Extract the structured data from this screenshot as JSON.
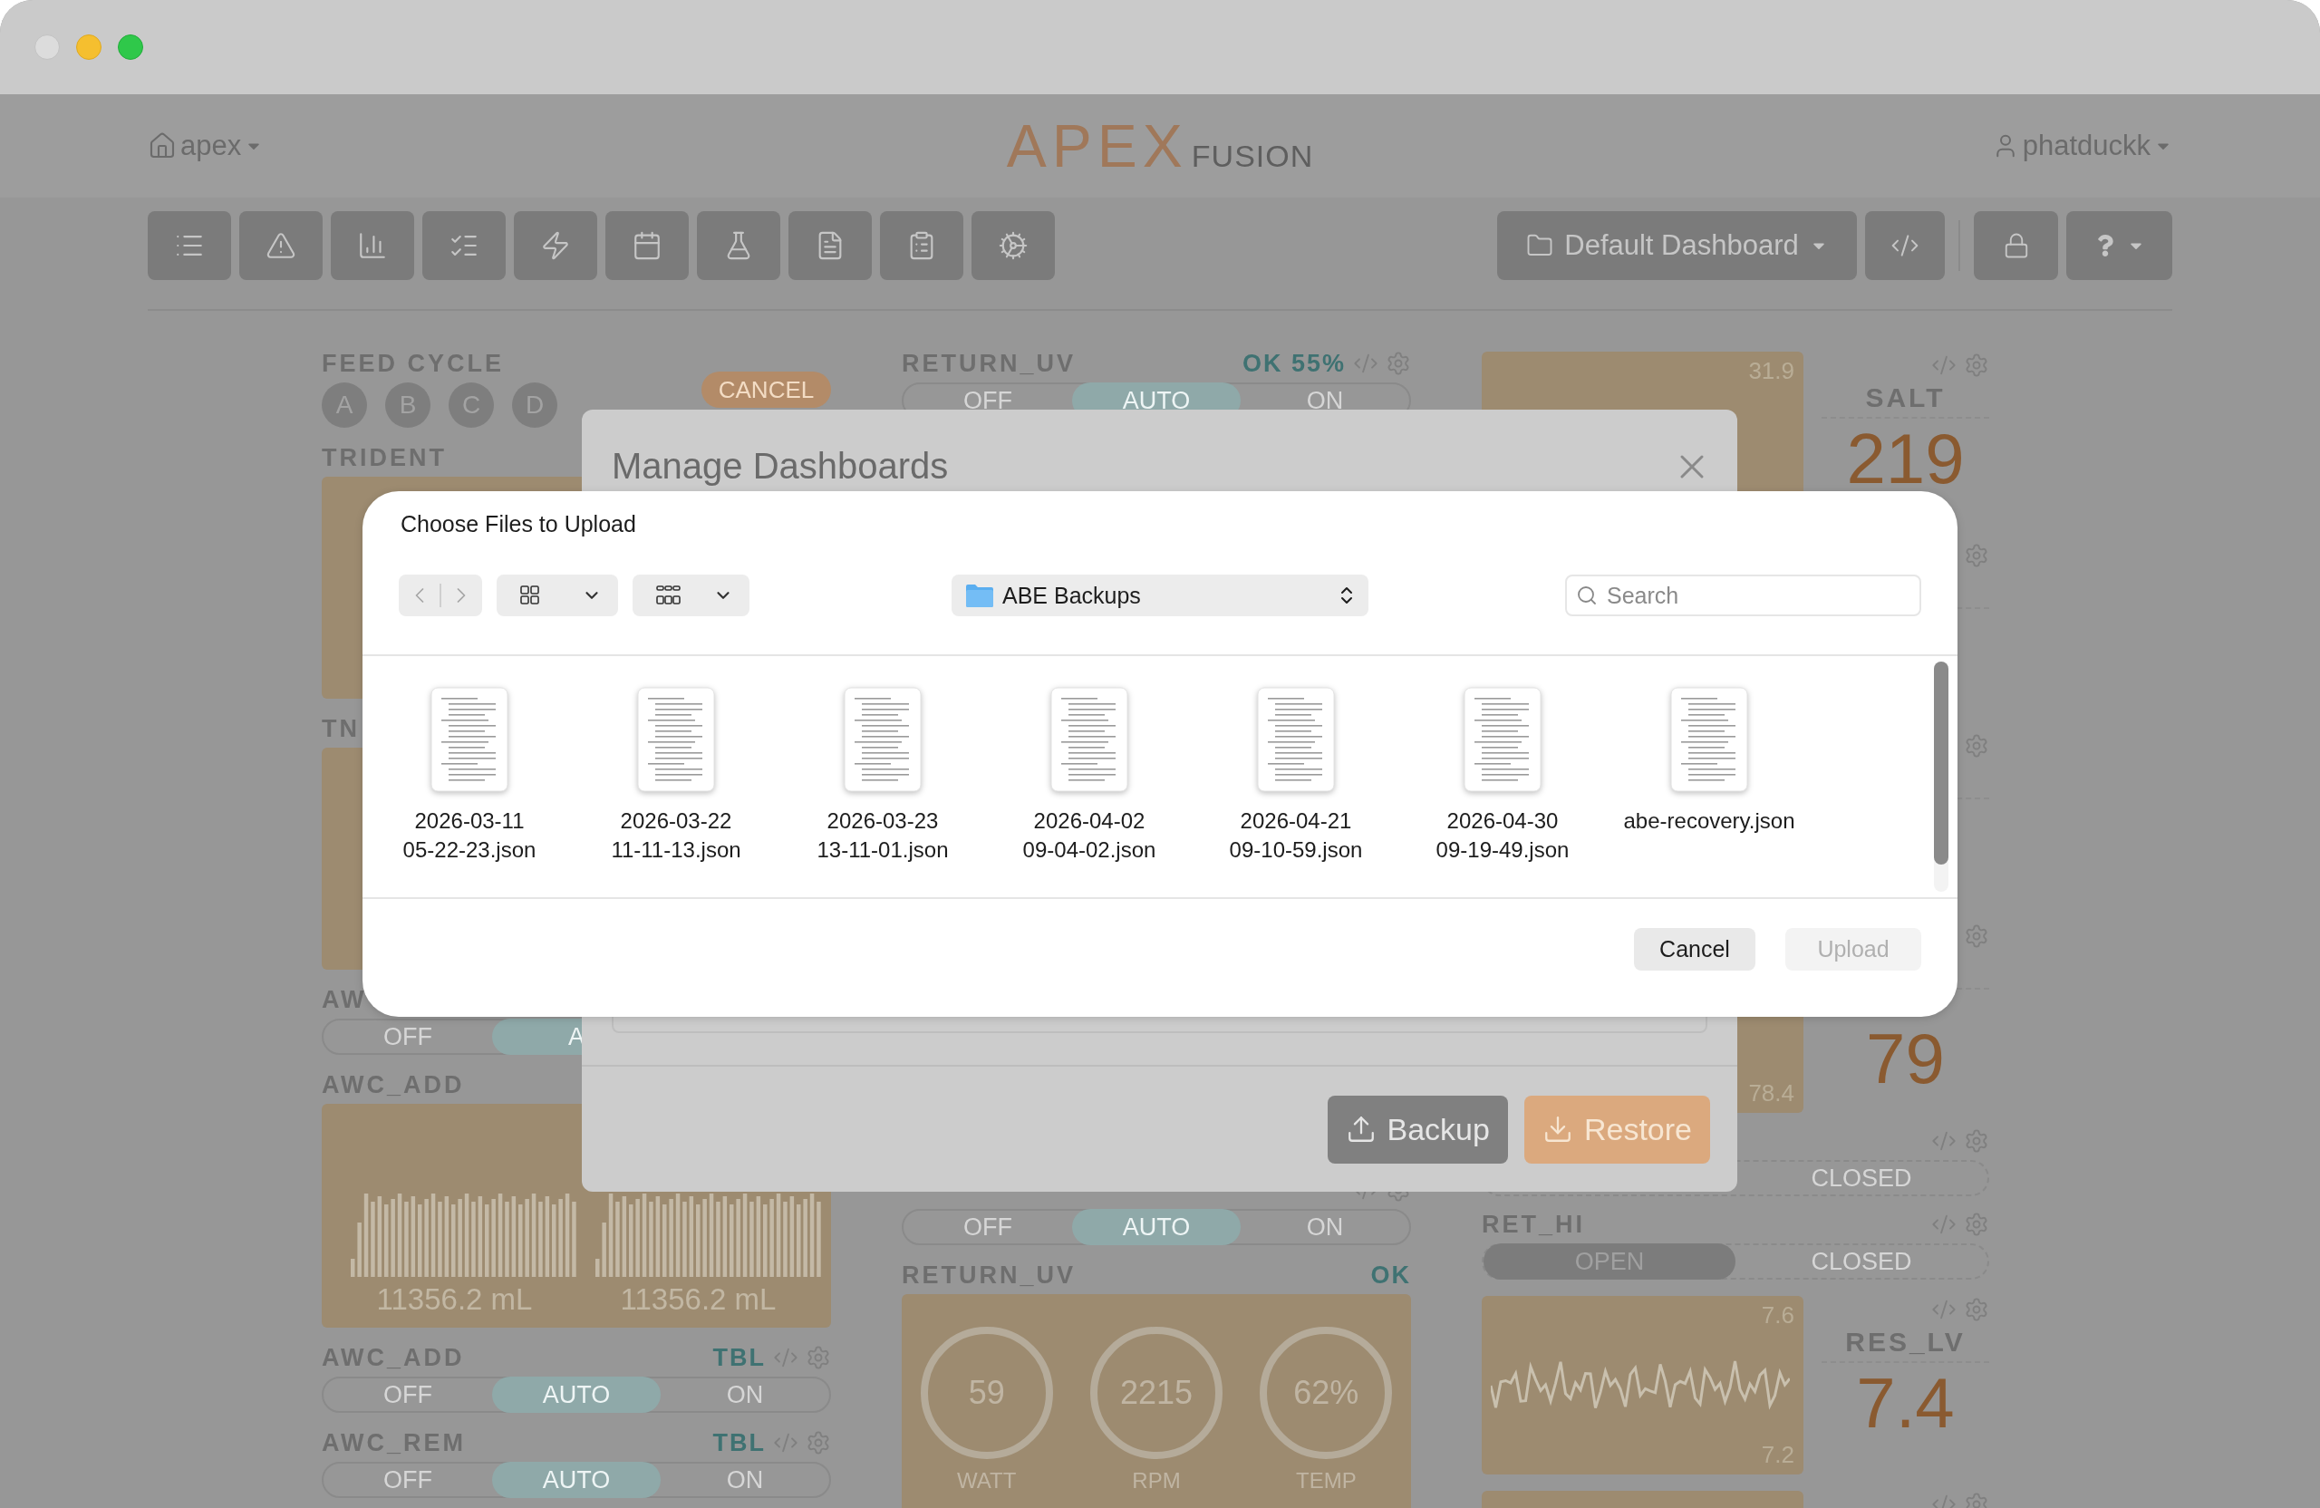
{
  "header": {
    "home": "apex",
    "logo": "APEX",
    "logo_sub": "FUSION",
    "user": "phatduckk"
  },
  "toolbar": {
    "dashboard": "Default Dashboard"
  },
  "dashboard": {
    "columns": [
      {
        "top": [
          {
            "kind": "feed",
            "title": "FEED CYCLE",
            "buttons": [
              "A",
              "B",
              "C",
              "D"
            ],
            "action": "CANCEL"
          },
          {
            "kind": "tile",
            "title": "TRIDENT"
          },
          {
            "kind": "tile",
            "title": "TN"
          },
          {
            "kind": "toggle",
            "title": "AW",
            "options": [
              {
                "label": "OFF",
                "selected": false
              },
              {
                "label": "A",
                "selected": true
              }
            ]
          },
          {
            "kind": "pump",
            "title": "AWC_ADD",
            "readings": [
              "11356.2 mL",
              "11356.2 mL"
            ]
          },
          {
            "kind": "toggle",
            "title": "AWC_ADD",
            "status": "TBL",
            "options": [
              {
                "label": "OFF",
                "selected": false
              },
              {
                "label": "AUTO",
                "selected": true
              },
              {
                "label": "ON",
                "selected": false
              }
            ]
          },
          {
            "kind": "toggle",
            "title": "AWC_REM",
            "status": "TBL",
            "options": [
              {
                "label": "OFF",
                "selected": false
              },
              {
                "label": "AUTO",
                "selected": true
              },
              {
                "label": "ON",
                "selected": false
              }
            ]
          }
        ]
      },
      {
        "top": [
          {
            "kind": "toggle",
            "title": "RETURN_UV",
            "status": "OK 55%",
            "options": [
              {
                "label": "OFF",
                "selected": false
              },
              {
                "label": "AUTO",
                "selected": true
              },
              {
                "label": "ON",
                "selected": false
              }
            ]
          }
        ],
        "bottom": [
          {
            "kind": "toggle",
            "options": [
              {
                "label": "OFF",
                "selected": false
              },
              {
                "label": "AUTO",
                "selected": true
              },
              {
                "label": "ON",
                "selected": false
              }
            ]
          },
          {
            "kind": "gauges",
            "title": "RETURN_UV",
            "status": "OK",
            "gauges": [
              {
                "value": "59",
                "unit": "WATT"
              },
              {
                "value": "2215",
                "unit": "RPM"
              },
              {
                "value": "62%",
                "unit": "TEMP"
              }
            ]
          }
        ]
      }
    ],
    "right": [
      {
        "kind": "readout",
        "top_label": "31.9",
        "bottom_label": "78.4",
        "probes": [
          {
            "kind": "probe",
            "title": "SALT",
            "value": "219"
          },
          {
            "kind": "probe"
          },
          {
            "kind": "probe"
          },
          {
            "kind": "probe",
            "value": "79"
          }
        ]
      },
      {
        "kind": "switch",
        "options": [
          {
            "label": "CLOSED",
            "selected": false
          }
        ]
      },
      {
        "kind": "switch",
        "title": "RET_HI",
        "options": [
          {
            "label": "OPEN",
            "selected": true
          },
          {
            "label": "CLOSED",
            "selected": false
          }
        ]
      },
      {
        "kind": "readout",
        "top_label": "7.6",
        "bottom_label": "7.2",
        "probes": [
          {
            "kind": "probe",
            "title": "RES_LV",
            "value": "7.4"
          }
        ]
      },
      {
        "kind": "readout",
        "probes": [
          {
            "kind": "probe"
          }
        ]
      }
    ]
  },
  "modal": {
    "title": "Manage Dashboards",
    "buttons": [
      {
        "kind": "backup",
        "label": "Backup"
      },
      {
        "kind": "restore",
        "label": "Restore"
      }
    ]
  },
  "file_dialog": {
    "title": "Choose Files to Upload",
    "location": "ABE Backups",
    "search": {
      "placeholder": "Search"
    },
    "files": [
      {
        "name": "2026-03-11 05-22-23.json"
      },
      {
        "name": "2026-03-22 11-11-13.json"
      },
      {
        "name": "2026-03-23 13-11-01.json"
      },
      {
        "name": "2026-04-02 09-04-02.json"
      },
      {
        "name": "2026-04-21 09-10-59.json"
      },
      {
        "name": "2026-04-30 09-19-49.json"
      },
      {
        "name": "abe-recovery.json"
      }
    ],
    "buttons": [
      {
        "label": "Cancel",
        "disabled": false
      },
      {
        "label": "Upload",
        "disabled": true
      }
    ]
  }
}
